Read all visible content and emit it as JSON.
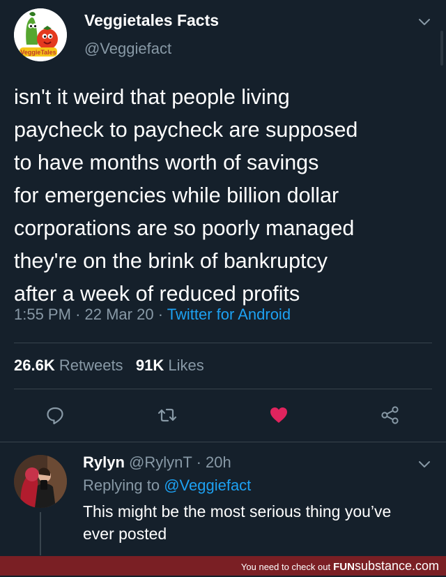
{
  "tweet": {
    "author": {
      "display_name": "Veggietales Facts",
      "handle": "@Veggiefact",
      "avatar_logo_text": "VeggieTales"
    },
    "text_lines": [
      "isn't it weird that people living",
      "paycheck to paycheck are supposed",
      "to have months worth of savings",
      "for emergencies while billion dollar",
      "corporations are so poorly managed",
      "they're on the brink of bankruptcy",
      "after a week of reduced profits"
    ],
    "time": "1:55 PM",
    "date": "22 Mar 20",
    "separator": "·",
    "source": "Twitter for Android",
    "stats": {
      "retweets_count": "26.6K",
      "retweets_label": "Retweets",
      "likes_count": "91K",
      "likes_label": "Likes"
    },
    "actions": [
      {
        "name": "reply-icon",
        "color": "#8899a6"
      },
      {
        "name": "retweet-icon",
        "color": "#8899a6"
      },
      {
        "name": "heart-icon",
        "color": "#e0245e",
        "liked": true
      },
      {
        "name": "share-icon",
        "color": "#8899a6"
      }
    ]
  },
  "reply": {
    "display_name": "Rylyn",
    "handle": "@RylynT",
    "separator": "·",
    "time_ago": "20h",
    "replying_to_label": "Replying to",
    "replying_to_handle": "@Veggiefact",
    "text_lines": [
      "This might be the most serious thing you’ve",
      "ever posted"
    ]
  },
  "footer": {
    "text": "You need to check out",
    "brand_part1": "FUN",
    "brand_part2": "substance.com"
  },
  "colors": {
    "background": "#15202b",
    "primary_text": "#ffffff",
    "secondary_text": "#8899a6",
    "link": "#1da1f2",
    "like": "#e0245e",
    "divider": "#38444d",
    "footer_bg": "#7a1f24"
  }
}
